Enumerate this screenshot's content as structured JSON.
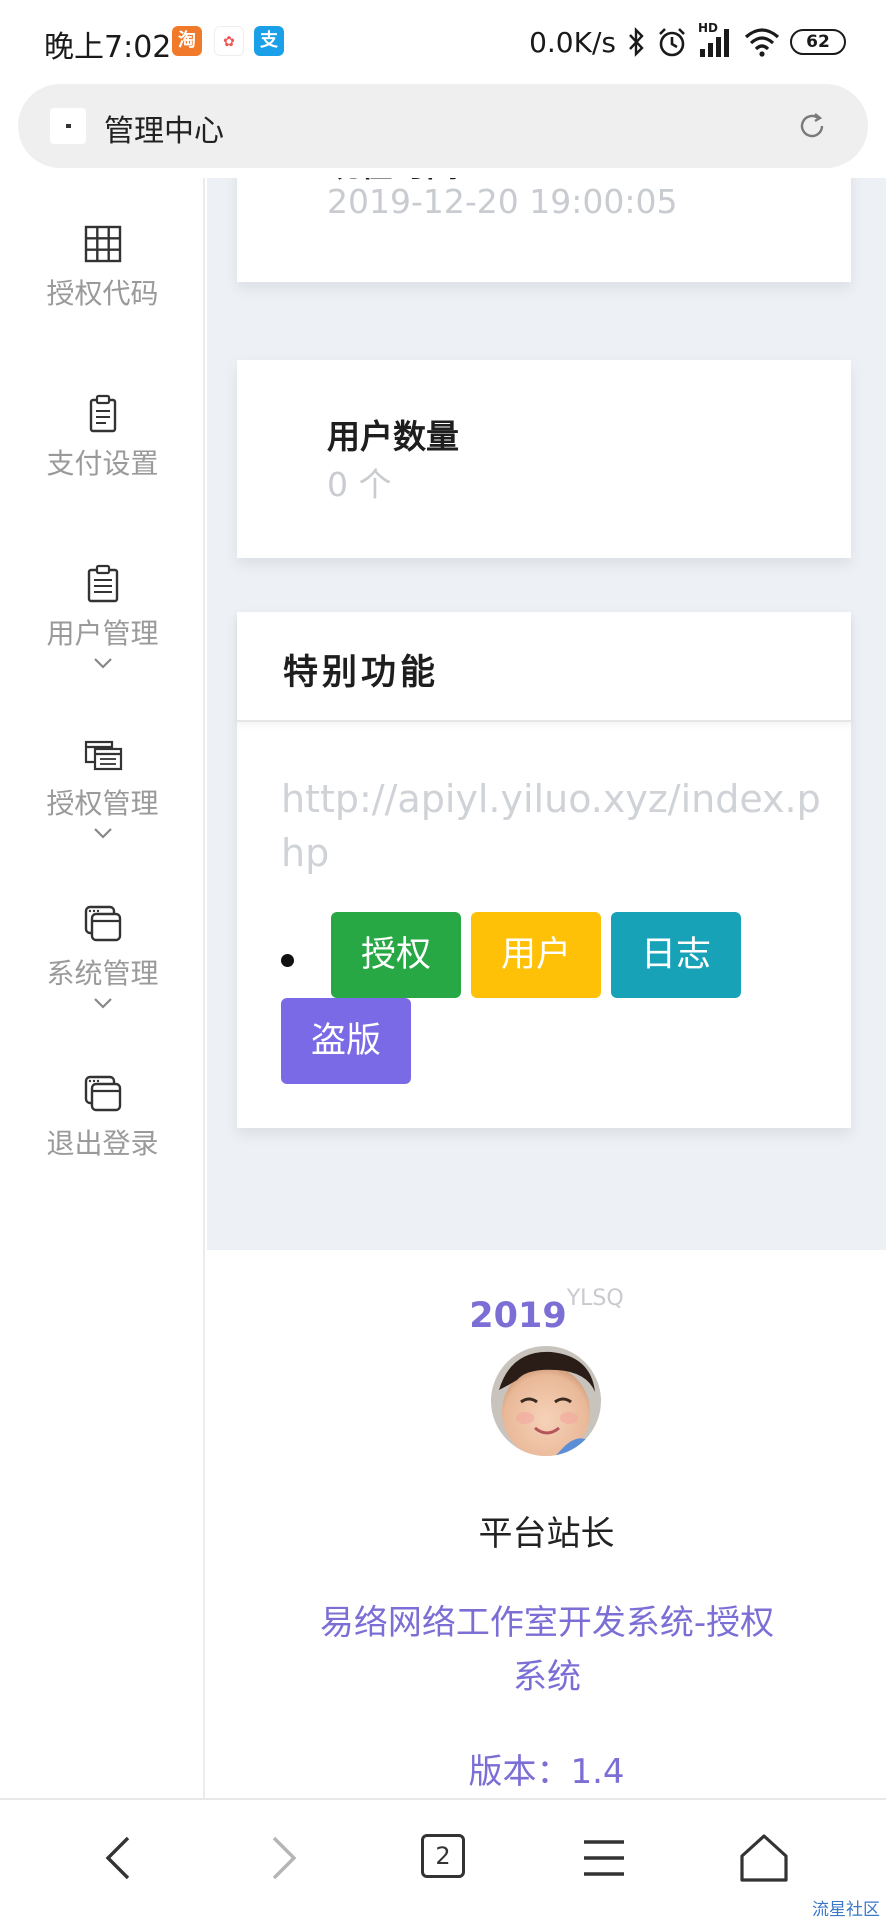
{
  "status_bar": {
    "time": "晚上7:02",
    "network_speed": "0.0K/s",
    "signal_label": "HD",
    "battery": "62"
  },
  "browser": {
    "page_title": "管理中心"
  },
  "sidebar": {
    "items": [
      {
        "label": "授权代码",
        "icon": "grid-icon",
        "has_submenu": false
      },
      {
        "label": "支付设置",
        "icon": "clipboard-icon",
        "has_submenu": false
      },
      {
        "label": "用户管理",
        "icon": "clipboard-list-icon",
        "has_submenu": true
      },
      {
        "label": "授权管理",
        "icon": "windows-icon",
        "has_submenu": true
      },
      {
        "label": "系统管理",
        "icon": "window-stack-icon",
        "has_submenu": true
      },
      {
        "label": "退出登录",
        "icon": "window-stack-icon",
        "has_submenu": false
      }
    ]
  },
  "cards": {
    "current_time": {
      "title": "现在时间",
      "value": "2019-12-20 19:00:05"
    },
    "user_count": {
      "title": "用户数量",
      "value": "0 个"
    }
  },
  "special": {
    "title": "特别功能",
    "url": "http://apiyl.yiluo.xyz/index.php",
    "buttons": [
      {
        "label": "授权",
        "color": "#28a745"
      },
      {
        "label": "用户",
        "color": "#ffc107"
      },
      {
        "label": "日志",
        "color": "#17a2b8"
      },
      {
        "label": "盗版",
        "color": "#7a6ae6"
      }
    ]
  },
  "footer": {
    "year": "2019",
    "brand": "YLSQ",
    "role": "平台站长",
    "system_name": "易络网络工作室开发系统-授权系统",
    "version": "版本：1.4"
  },
  "bottom_nav": {
    "tab_count": "2"
  },
  "watermark": "流星社区",
  "colors": {
    "accent": "#7b6fd6",
    "background": "#edf1f5"
  }
}
